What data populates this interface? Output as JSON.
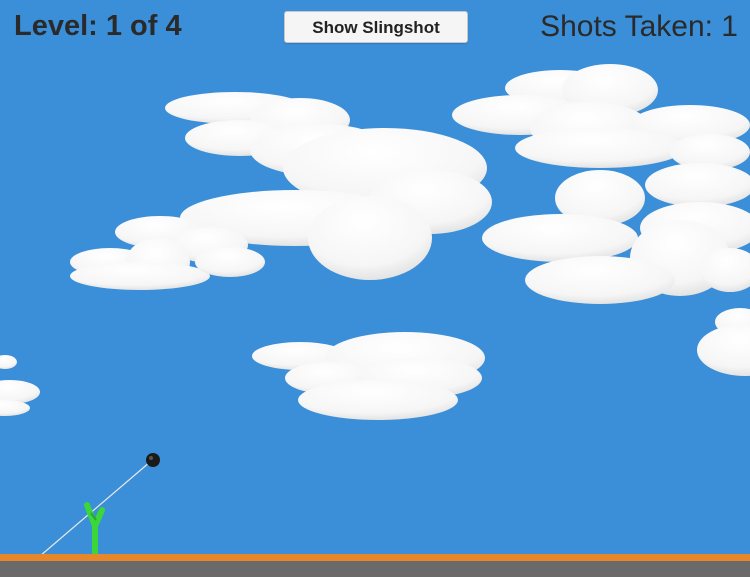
{
  "hud": {
    "level_text": "Level: 1 of 4",
    "shots_text": "Shots Taken: 1",
    "slingshot_button_label": "Show Slingshot"
  },
  "colors": {
    "sky": "#3a8fd8",
    "cloud": "#ffffff",
    "ground_top": "#e8872a",
    "ground": "#6a6a6a",
    "slingshot": "#3ad63a",
    "projectile": "#1a1a1a"
  }
}
